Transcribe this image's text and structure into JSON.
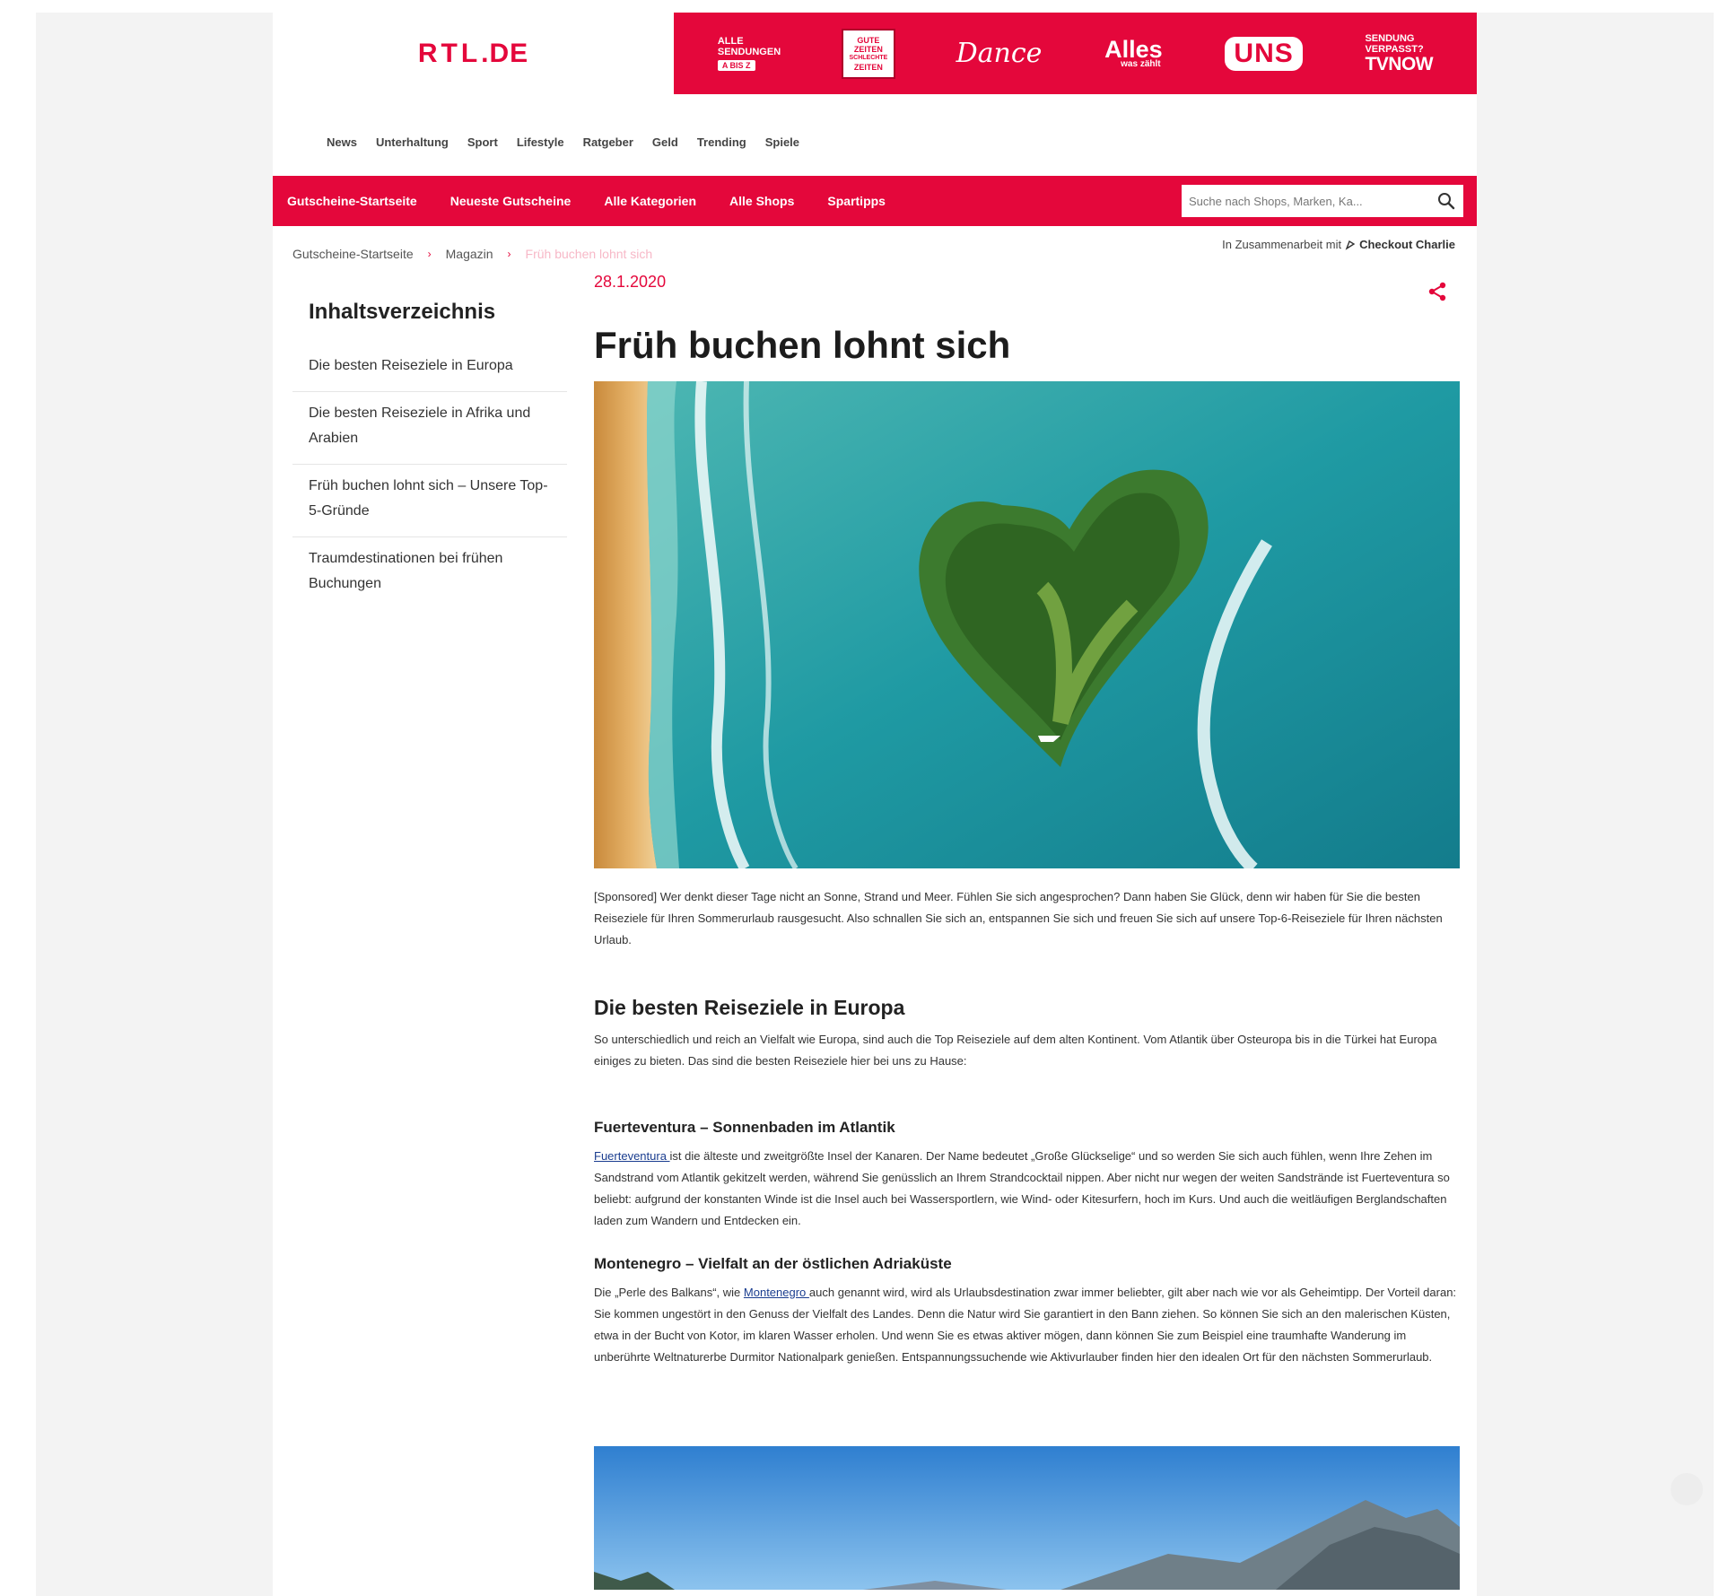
{
  "header": {
    "logo_main": "RTL",
    "logo_suffix": ".DE",
    "brands": {
      "alle_sendungen": {
        "line1": "ALLE",
        "line2": "SENDUNGEN",
        "tag": "A BIS Z"
      },
      "gzsz": {
        "line1": "GUTE",
        "line2": "ZEITEN",
        "line3": "SCHLECHTE",
        "line4": "ZEITEN"
      },
      "dance": "Dance",
      "alles_was_zaehlt": {
        "main": "Alles",
        "sub": "was zählt"
      },
      "unter_uns": "UNS",
      "tvnow": {
        "line1": "SENDUNG",
        "line2": "VERPASST?",
        "big": "TVNOW"
      }
    }
  },
  "nav": {
    "items": [
      "News",
      "Unterhaltung",
      "Sport",
      "Lifestyle",
      "Ratgeber",
      "Geld",
      "Trending",
      "Spiele"
    ]
  },
  "redbar": {
    "items": [
      "Gutscheine-Startseite",
      "Neueste Gutscheine",
      "Alle Kategorien",
      "Alle Shops",
      "Spartipps"
    ],
    "search_placeholder": "Suche nach Shops, Marken, Ka..."
  },
  "breadcrumb": {
    "items": [
      "Gutscheine-Startseite",
      "Magazin",
      "Früh buchen lohnt sich"
    ],
    "separator": "›"
  },
  "partner": {
    "prefix": "In Zusammenarbeit mit",
    "name": "Checkout Charlie"
  },
  "toc": {
    "title": "Inhaltsverzeichnis",
    "items": [
      "Die besten Reiseziele in Europa",
      "Die besten Reiseziele in Afrika und Arabien",
      "Früh buchen lohnt sich – Unsere Top-5-Gründe",
      "Traumdestinationen bei frühen Buchungen"
    ]
  },
  "article": {
    "date": "28.1.2020",
    "title": "Früh buchen lohnt sich",
    "intro": "[Sponsored] Wer denkt dieser Tage nicht an Sonne, Strand und Meer. Fühlen Sie sich angesprochen? Dann haben Sie Glück, denn wir haben für Sie die besten Reiseziele für Ihren Sommerurlaub rausgesucht. Also schnallen Sie sich an, entspannen Sie sich und freuen Sie sich auf unsere Top-6-Reiseziele für Ihren nächsten Urlaub.",
    "section1_title": "Die besten Reiseziele in Europa",
    "section1_text": "So unterschiedlich und reich an Vielfalt wie Europa, sind auch die Top Reiseziele auf dem alten Kontinent. Vom Atlantik über Osteuropa bis in die Türkei hat Europa einiges zu bieten. Das sind die besten Reiseziele hier bei uns zu Hause:",
    "sub1_title": "Fuerteventura – Sonnenbaden im Atlantik",
    "sub1_link": "Fuerteventura ",
    "sub1_text": "ist die älteste und zweitgrößte Insel der Kanaren. Der Name bedeutet „Große Glückselige“ und so werden Sie sich auch fühlen, wenn Ihre Zehen im Sandstrand vom Atlantik gekitzelt werden, während Sie genüsslich an Ihrem Strandcocktail nippen. Aber nicht nur wegen der weiten Sandstrände ist Fuerteventura so beliebt: aufgrund der konstanten Winde ist die Insel auch bei Wassersportlern, wie Wind- oder Kitesurfern, hoch im Kurs. Und auch die weitläufigen Berglandschaften laden zum Wandern und Entdecken ein.",
    "sub2_title": "Montenegro – Vielfalt an der östlichen Adriaküste",
    "sub2_pre": "Die „Perle des Balkans“, wie ",
    "sub2_link": "Montenegro ",
    "sub2_text": "auch genannt wird, wird als Urlaubsdestination zwar immer beliebter, gilt aber nach wie vor als Geheimtipp. Der Vorteil daran: Sie kommen ungestört in den Genuss der Vielfalt des Landes. Denn die Natur wird Sie garantiert in den Bann ziehen. So können Sie sich an den malerischen Küsten, etwa in der Bucht von Kotor, im klaren Wasser erholen. Und wenn Sie es etwas aktiver mögen, dann können Sie zum Beispiel eine traumhafte Wanderung im unberührte Weltnaturerbe Durmitor Nationalpark genießen. Entspannungssuchende wie Aktivurlauber finden hier den idealen Ort für den nächsten Sommerurlaub."
  },
  "colors": {
    "brand_red": "#e4073b",
    "link_blue": "#1a3d8f",
    "page_bg": "#f3f3f3"
  },
  "icons": [
    "search-icon",
    "share-icon",
    "checkout-charlie-icon",
    "scroll-top-icon"
  ]
}
